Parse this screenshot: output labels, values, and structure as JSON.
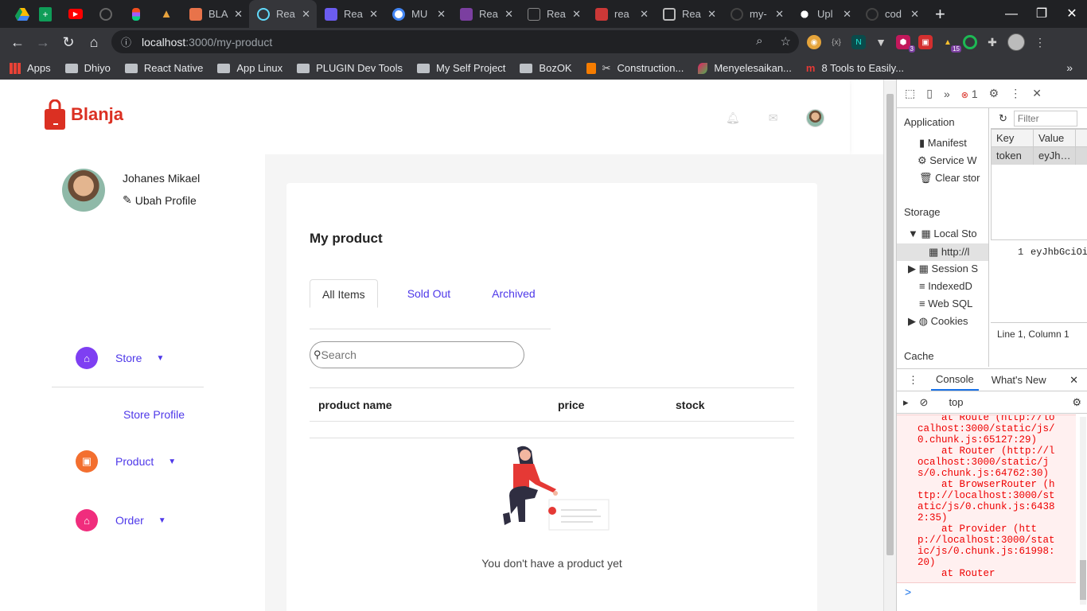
{
  "browser": {
    "tabs": [
      {
        "label": "BLA",
        "color": "#e8734a"
      },
      {
        "label": "Rea",
        "color": "#61dafb"
      },
      {
        "label": "Rea",
        "color": "#6b5cf0"
      },
      {
        "label": "MU",
        "color": "#4285f4"
      },
      {
        "label": "Rea",
        "color": "#7b3fa0"
      },
      {
        "label": "Rea",
        "color": "#888888"
      },
      {
        "label": "rea",
        "color": "#cb3837"
      },
      {
        "label": "Rea",
        "color": "#bbbbbb"
      },
      {
        "label": "my-",
        "color": "#444444"
      },
      {
        "label": "Upl",
        "color": "#ffffff"
      },
      {
        "label": "cod",
        "color": "#444444"
      }
    ],
    "url_host": "localhost",
    "url_path": ":3000/my-product",
    "bookmarks": [
      "Apps",
      "Dhiyo",
      "React Native",
      "App Linux",
      "PLUGIN Dev Tools",
      "My Self Project",
      "BozOK",
      "Construction...",
      "Menyelesaikan...",
      "8 Tools to Easily..."
    ],
    "ext_badges": {
      "a": "3",
      "b": "15"
    }
  },
  "app": {
    "brand": "Blanja",
    "brand_color": "#db3022",
    "user_name": "Johanes Mikael",
    "edit_profile": "Ubah Profile",
    "menu": [
      {
        "label": "Store",
        "color": "#7e3ff2"
      },
      {
        "label": "Product",
        "color": "#f36f2f"
      },
      {
        "label": "Order",
        "color": "#f02d7d"
      }
    ],
    "store_sub": "Store Profile",
    "page_title": "My product",
    "tabs": [
      "All Items",
      "Sold Out",
      "Archived"
    ],
    "search_placeholder": "Search",
    "columns": [
      "product name",
      "price",
      "stock"
    ],
    "empty_message": "You don't have a product yet"
  },
  "devtools": {
    "error_count": "1",
    "app_header": "Application",
    "app_items": [
      "Manifest",
      "Service W",
      "Clear stor"
    ],
    "storage_header": "Storage",
    "storage_items": [
      "Local Sto",
      "http://l",
      "Session S",
      "IndexedD",
      "Web SQL",
      "Cookies"
    ],
    "cache_header": "Cache",
    "filter_placeholder": "Filter",
    "kv_headers": [
      "Key",
      "Value"
    ],
    "kv_row": [
      "token",
      "eyJh…"
    ],
    "value_line_no": "1",
    "value_preview": "eyJhbGciOi",
    "line_info": "Line 1, Column 1",
    "console_tabs": [
      "Console",
      "What's New"
    ],
    "context": "top",
    "log_lines": [
      "    at Route (http://lo",
      "calhost:3000/static/js/",
      "0.chunk.js:65127:29)",
      "    at Router (http://l",
      "ocalhost:3000/static/j",
      "s/0.chunk.js:64762:30)",
      "    at BrowserRouter (h",
      "ttp://localhost:3000/st",
      "atic/js/0.chunk.js:6438",
      "2:35)",
      "    at Provider (htt",
      "p://localhost:3000/stat",
      "ic/js/0.chunk.js:61998:",
      "20)",
      "    at Router"
    ],
    "prompt": ">"
  }
}
